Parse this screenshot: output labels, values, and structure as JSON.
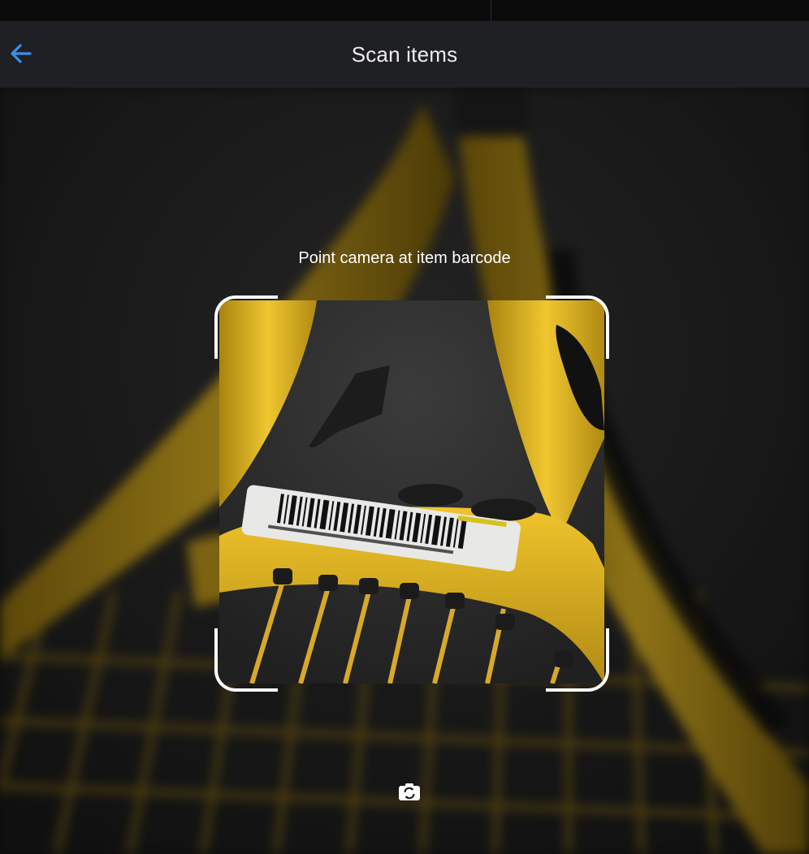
{
  "header": {
    "title": "Scan items",
    "back_icon": "arrow-left-icon",
    "accent_color": "#3b8fe6"
  },
  "scanner": {
    "instruction": "Point camera at item barcode",
    "switch_camera_icon": "camera-switch-icon"
  },
  "colors": {
    "header_bg": "#1f2023",
    "frame": "#ffffff",
    "racket_yellow": "#e3b51f"
  }
}
